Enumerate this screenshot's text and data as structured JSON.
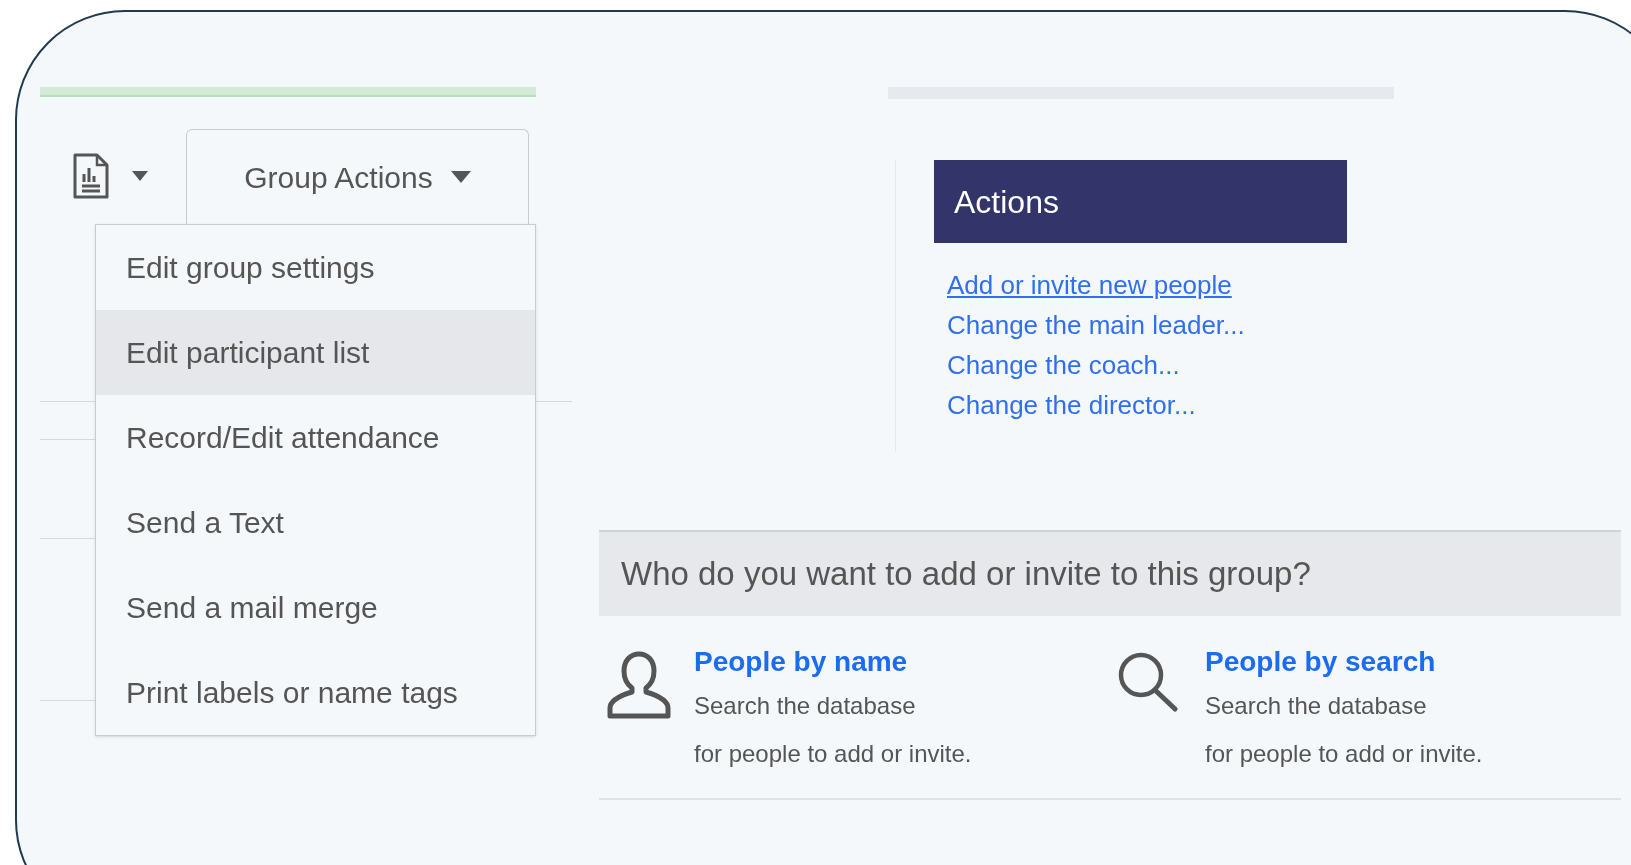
{
  "toolbar": {
    "group_actions": {
      "label": "Group Actions"
    }
  },
  "group_actions_menu": [
    {
      "label": "Edit group settings",
      "selected": false
    },
    {
      "label": "Edit participant list",
      "selected": true
    },
    {
      "label": "Record/Edit attendance",
      "selected": false
    },
    {
      "label": "Send a Text",
      "selected": false
    },
    {
      "label": "Send a mail merge",
      "selected": false
    },
    {
      "label": "Print labels or name tags",
      "selected": false
    }
  ],
  "actions": {
    "title": "Actions",
    "links": [
      {
        "label": "Add or invite new people",
        "hovered": true
      },
      {
        "label": "Change the main leader...",
        "hovered": false
      },
      {
        "label": "Change the coach...",
        "hovered": false
      },
      {
        "label": "Change the director...",
        "hovered": false
      }
    ]
  },
  "add_people": {
    "question": "Who do you want to add or invite to this group?",
    "options": [
      {
        "kind": "person",
        "title": "People by name",
        "lines": [
          "Search the database",
          "for people to add or invite."
        ]
      },
      {
        "kind": "search",
        "title": "People by search",
        "lines": [
          "Search the database",
          "for people to add or invite."
        ]
      }
    ]
  }
}
